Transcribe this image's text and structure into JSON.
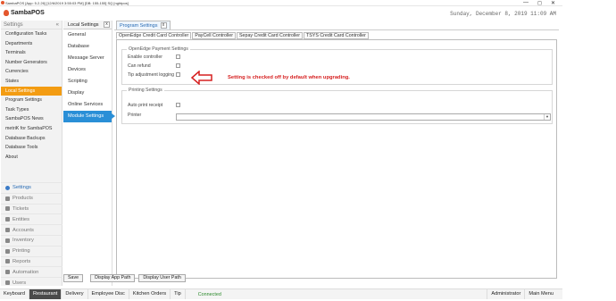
{
  "window": {
    "title": "SambaPOS [App: 5.2.26] [12/6/2019 3:55:03 PM] [DB: 155-155] SQ [nghtpos]",
    "controls": [
      "—",
      "◻",
      "✕"
    ]
  },
  "app": {
    "brand": "SambaPOS",
    "date": "Sunday, December 8, 2019 11:09 AM"
  },
  "sidebar": {
    "header": "Settings",
    "toggle": "«",
    "items": [
      {
        "label": "Configuration Tasks"
      },
      {
        "label": "Departments"
      },
      {
        "label": "Terminals"
      },
      {
        "label": "Number Generators"
      },
      {
        "label": "Currencies"
      },
      {
        "label": "States"
      },
      {
        "label": "Local Settings"
      },
      {
        "label": "Program Settings"
      },
      {
        "label": "Task Types"
      },
      {
        "label": "SambaPOS News"
      },
      {
        "label": "metriK for SambaPOS"
      },
      {
        "label": "Database Backups"
      },
      {
        "label": "Database Tools"
      },
      {
        "label": "About"
      }
    ],
    "nav": [
      {
        "label": "Settings"
      },
      {
        "label": "Products"
      },
      {
        "label": "Tickets"
      },
      {
        "label": "Entities"
      },
      {
        "label": "Accounts"
      },
      {
        "label": "Inventory"
      },
      {
        "label": "Printing"
      },
      {
        "label": "Reports"
      },
      {
        "label": "Automation"
      },
      {
        "label": "Users"
      }
    ]
  },
  "local_settings": {
    "tab_label": "Local Settings",
    "close": "x",
    "items": [
      {
        "label": "General"
      },
      {
        "label": "Database"
      },
      {
        "label": "Message Server"
      },
      {
        "label": "Devices"
      },
      {
        "label": "Scripting"
      },
      {
        "label": "Display"
      },
      {
        "label": "Online Services"
      },
      {
        "label": "Module Settings"
      }
    ]
  },
  "program_settings": {
    "tab_label": "Program Settings",
    "close": "x",
    "subtabs": [
      {
        "label": "OpenEdge Credit Card Controller"
      },
      {
        "label": "PayCell Controller"
      },
      {
        "label": "Sepay Credit Card Controller"
      },
      {
        "label": "TSYS Credit Card Controller"
      }
    ],
    "payment_group": {
      "title": "OpenEdge Payment Settings",
      "options": [
        {
          "label": "Enable controller",
          "checked": false
        },
        {
          "label": "Can refund",
          "checked": false
        },
        {
          "label": "Tip adjustment logging",
          "checked": false
        }
      ]
    },
    "printing_group": {
      "title": "Printing Settings",
      "auto_print_label": "Auto print receipt",
      "printer_label": "Printer",
      "printer_value": ""
    },
    "annotation": "Setting is checked off by default when upgrading.",
    "annotation_color": "#d62020"
  },
  "actions": {
    "save": "Save",
    "display_app_path": "Display App Path",
    "display_user_path": "Display User Path"
  },
  "statusbar": {
    "items": [
      {
        "label": "Keyboard"
      },
      {
        "label": "Restaurant"
      },
      {
        "label": "Delivery"
      },
      {
        "label": "Employee Disc"
      },
      {
        "label": "Kitchen Orders"
      },
      {
        "label": "Tip"
      }
    ],
    "connection": "Connected",
    "user": "Administrator",
    "main_menu": "Main Menu"
  },
  "colors": {
    "accent_orange": "#f39c12",
    "accent_blue": "#2a8fd7",
    "connected_green": "#2c8a2c"
  }
}
